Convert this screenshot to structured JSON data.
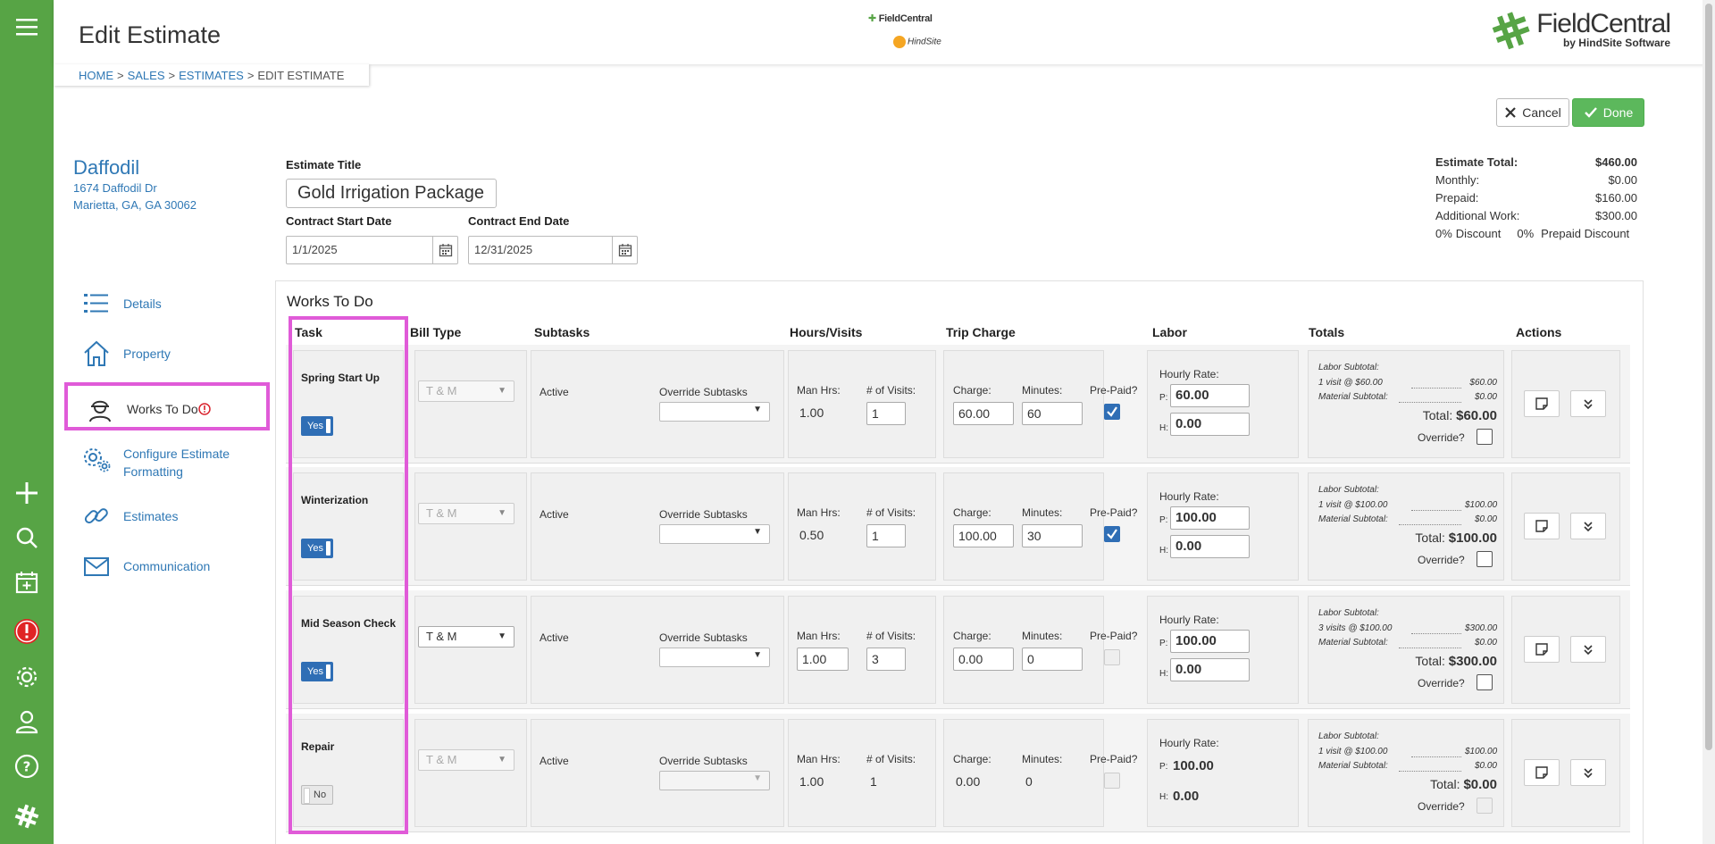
{
  "header": {
    "title": "Edit Estimate",
    "breadcrumb": [
      "HOME",
      "SALES",
      "ESTIMATES",
      "EDIT ESTIMATE"
    ],
    "mini_logo_top": "FieldCentral",
    "mini_logo_bottom": "HindSite",
    "brand_name": "FieldCentral",
    "brand_sub": "by HindSite Software"
  },
  "buttons": {
    "cancel": "Cancel",
    "done": "Done"
  },
  "customer": {
    "name": "Daffodil",
    "address1": "1674 Daffodil Dr",
    "address2": "Marietta, GA, GA 30062"
  },
  "nav": {
    "details": "Details",
    "property": "Property",
    "works_to_do": "Works To Do",
    "configure_1": "Configure Estimate",
    "configure_2": "Formatting",
    "estimates": "Estimates",
    "communication": "Communication"
  },
  "form": {
    "title_label": "Estimate Title",
    "title_value": "Gold Irrigation Package",
    "start_label": "Contract Start Date",
    "start_value": "1/1/2025",
    "end_label": "Contract End Date",
    "end_value": "12/31/2025"
  },
  "totals": {
    "total_label": "Estimate Total:",
    "total_value": "$460.00",
    "monthly_label": "Monthly:",
    "monthly_value": "$0.00",
    "prepaid_label": "Prepaid:",
    "prepaid_value": "$160.00",
    "additional_label": "Additional Work:",
    "additional_value": "$300.00",
    "discount_pct": "0%",
    "discount_label": "Discount",
    "prepaid_discount_pct": "0%",
    "prepaid_discount_label": "Prepaid Discount"
  },
  "works": {
    "title": "Works To Do",
    "columns": [
      "Task",
      "Bill Type",
      "Subtasks",
      "Hours/Visits",
      "Trip Charge",
      "Labor",
      "Totals",
      "Actions"
    ],
    "labels": {
      "active": "Active",
      "override_subtasks": "Override Subtasks",
      "man_hrs": "Man Hrs:",
      "visits": "# of Visits:",
      "charge": "Charge:",
      "minutes": "Minutes:",
      "prepaid": "Pre-Paid?",
      "hourly_rate": "Hourly Rate:",
      "p": "P:",
      "h": "H:",
      "labor_subtotal": "Labor Subtotal:",
      "material_subtotal": "Material Subtotal:",
      "total": "Total:",
      "override": "Override?"
    },
    "tasks": [
      {
        "name": "Spring Start Up",
        "toggle": "Yes",
        "bill_type": "T & M",
        "man_hrs": "1.00",
        "visits": "1",
        "charge": "60.00",
        "minutes": "60",
        "rate_p": "60.00",
        "rate_h": "0.00",
        "labor_line": "1 visit @ $60.00",
        "labor_amt": "$60.00",
        "material_amt": "$0.00",
        "total": "$60.00"
      },
      {
        "name": "Winterization",
        "toggle": "Yes",
        "bill_type": "T & M",
        "man_hrs": "0.50",
        "visits": "1",
        "charge": "100.00",
        "minutes": "30",
        "rate_p": "100.00",
        "rate_h": "0.00",
        "labor_line": "1 visit @ $100.00",
        "labor_amt": "$100.00",
        "material_amt": "$0.00",
        "total": "$100.00"
      },
      {
        "name": "Mid Season Check",
        "toggle": "Yes",
        "bill_type": "T & M",
        "man_hrs": "1.00",
        "visits": "3",
        "charge": "0.00",
        "minutes": "0",
        "rate_p": "100.00",
        "rate_h": "0.00",
        "labor_line": "3 visits @ $100.00",
        "labor_amt": "$300.00",
        "material_amt": "$0.00",
        "total": "$300.00"
      },
      {
        "name": "Repair",
        "toggle": "No",
        "bill_type": "T & M",
        "man_hrs": "1.00",
        "visits": "1",
        "charge": "0.00",
        "minutes": "0",
        "rate_p": "100.00",
        "rate_h": "0.00",
        "labor_line": "1 visit @ $100.00",
        "labor_amt": "$100.00",
        "material_amt": "$0.00",
        "total": "$0.00"
      }
    ]
  },
  "colors": {
    "rail": "#57a445",
    "link": "#2f78b5",
    "highlight": "#e05bd8",
    "toggle_on": "#2f6eb5",
    "done": "#5cb85c"
  }
}
